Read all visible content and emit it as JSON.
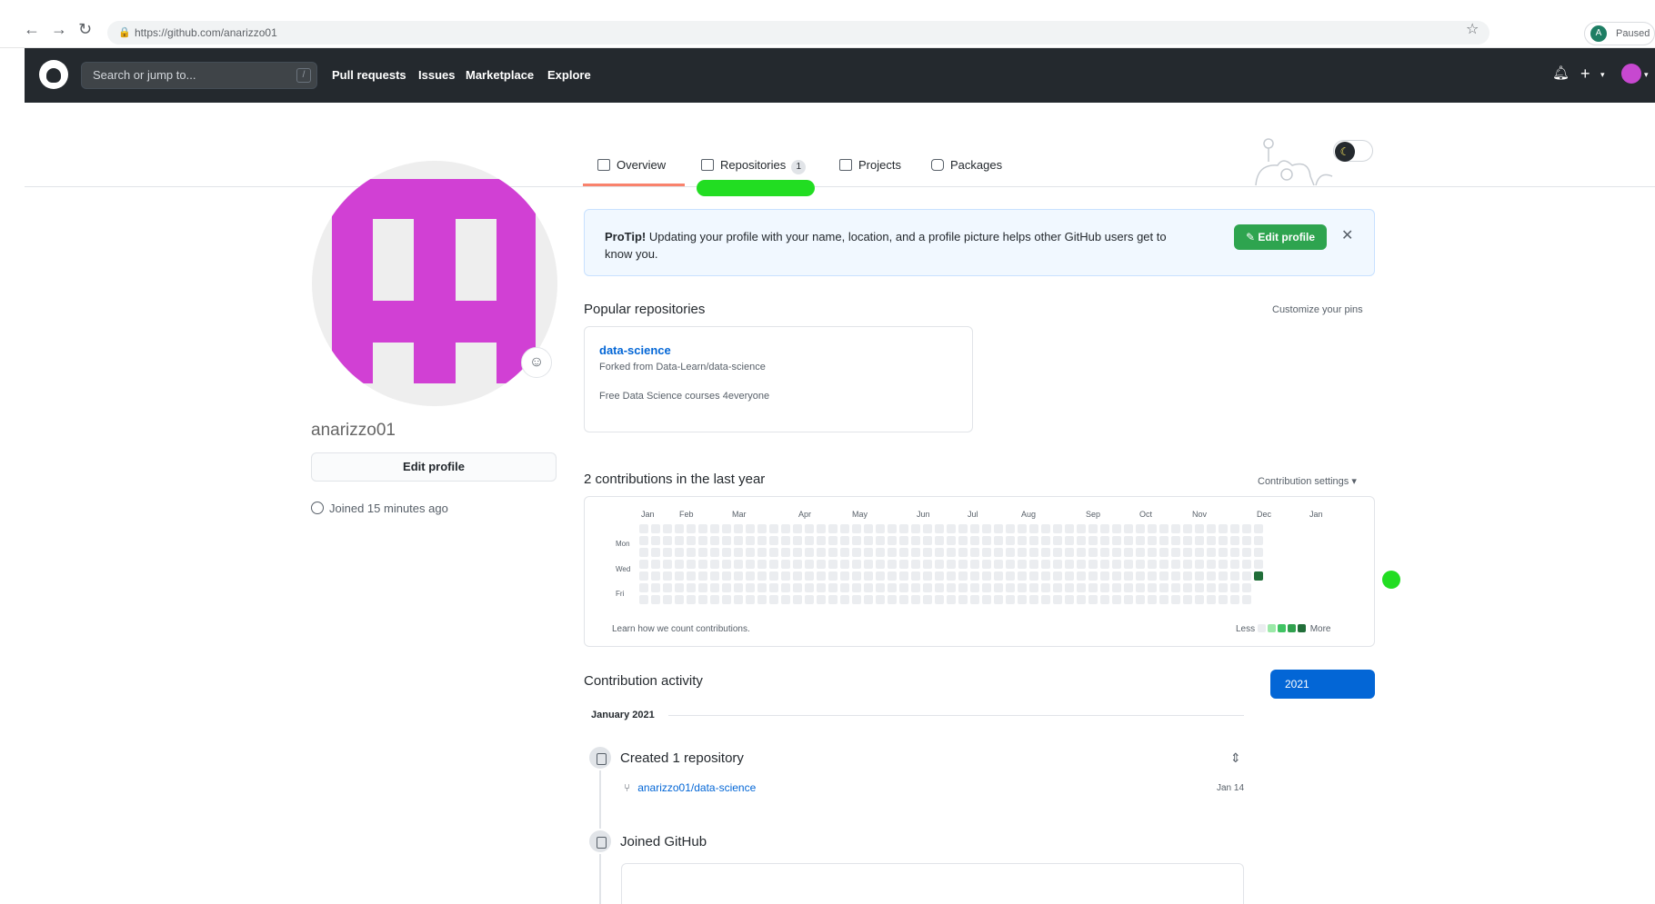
{
  "browser": {
    "url": "https://github.com/anarizzo01",
    "profile_initial": "A",
    "paused_label": "Paused"
  },
  "header": {
    "search_placeholder": "Search or jump to...",
    "search_shortcut": "/",
    "nav": [
      "Pull requests",
      "Issues",
      "Marketplace",
      "Explore"
    ],
    "plus_label": "+"
  },
  "profile": {
    "username": "anarizzo01",
    "edit_button": "Edit profile",
    "joined": "Joined 15 minutes ago"
  },
  "tabs": [
    {
      "label": "Overview",
      "active": true
    },
    {
      "label": "Repositories",
      "counter": "1"
    },
    {
      "label": "Projects"
    },
    {
      "label": "Packages"
    }
  ],
  "protip": {
    "lead": "ProTip!",
    "text": "Updating your profile with your name, location, and a profile picture helps other GitHub users get to know you.",
    "button": "Edit profile",
    "close": "✕"
  },
  "popular": {
    "heading": "Popular repositories",
    "customize": "Customize your pins",
    "repo": {
      "name": "data-science",
      "forked_from": "Forked from Data-Learn/data-science",
      "description": "Free Data Science courses 4everyone"
    }
  },
  "contributions": {
    "heading": "2 contributions in the last year",
    "settings": "Contribution settings ▾",
    "months": [
      "Jan",
      "Feb",
      "Mar",
      "Apr",
      "May",
      "Jun",
      "Jul",
      "Aug",
      "Sep",
      "Oct",
      "Nov",
      "Dec",
      "Jan"
    ],
    "day_labels": [
      "Mon",
      "Wed",
      "Fri"
    ],
    "learn": "Learn how we count contributions.",
    "legend_less": "Less",
    "legend_more": "More",
    "colors": [
      "#ebedf0",
      "#9be9a8",
      "#40c463",
      "#30a14e",
      "#216e39"
    ]
  },
  "activity": {
    "heading": "Contribution activity",
    "year": "2021",
    "month": "January 2021",
    "created_title": "Created 1 repository",
    "repo": "anarizzo01/data-science",
    "repo_date": "Jan 14",
    "joined_title": "Joined GitHub"
  }
}
